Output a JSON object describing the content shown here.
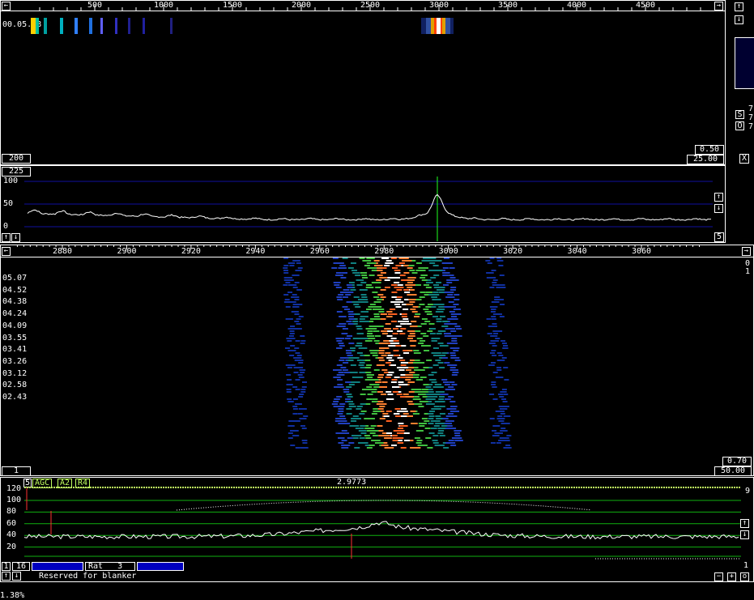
{
  "top_scale": {
    "ticks": [
      "500",
      "1000",
      "1500",
      "2000",
      "2500",
      "3000",
      "3500",
      "4000",
      "4500"
    ]
  },
  "top_waterfall": {
    "timestamp": "00.05.08",
    "lower_left": "200",
    "lower_right_top": "0.50",
    "lower_right_bottom": "25.00"
  },
  "spectrum": {
    "top_left": "225",
    "y_labels": [
      "100",
      "50",
      "0"
    ],
    "bottom_right": "5"
  },
  "zoom_scale": {
    "ticks": [
      "2880",
      "2900",
      "2920",
      "2940",
      "2960",
      "2980",
      "3000",
      "3020",
      "3040",
      "3060"
    ]
  },
  "zoom_waterfall": {
    "time_labels": [
      "05.07",
      "04.52",
      "04.38",
      "04.24",
      "04.09",
      "03.55",
      "03.41",
      "03.26",
      "03.12",
      "02.58",
      "02.43"
    ],
    "right_top": "0",
    "right_second": "1",
    "lower_left": "1",
    "lower_right_top": "0.70",
    "lower_right_bottom": "50.00"
  },
  "baseband": {
    "left_value": "5",
    "tags": [
      "AGC",
      "A2",
      "R4"
    ],
    "frequency": "2.9773",
    "y_labels": [
      "120",
      "100",
      "80",
      "60",
      "40",
      "20"
    ],
    "right_label": "9",
    "right_bottom_label": "1"
  },
  "bottom_bar": {
    "counter": "16",
    "rat_label": "Rat",
    "rat_value": "3",
    "status_text": "Reserved for blanker"
  },
  "side_panel": {
    "labels": [
      "S",
      "O"
    ],
    "digits": [
      "7",
      "7",
      "7"
    ],
    "x_button": "X"
  },
  "footer": {
    "text": "1.38%"
  },
  "colors": {
    "grid_blue": "#1010a0",
    "grid_green": "#10b010",
    "trace": "#ffffff",
    "marker": "#20ff20",
    "peak_red": "#ff3030"
  }
}
